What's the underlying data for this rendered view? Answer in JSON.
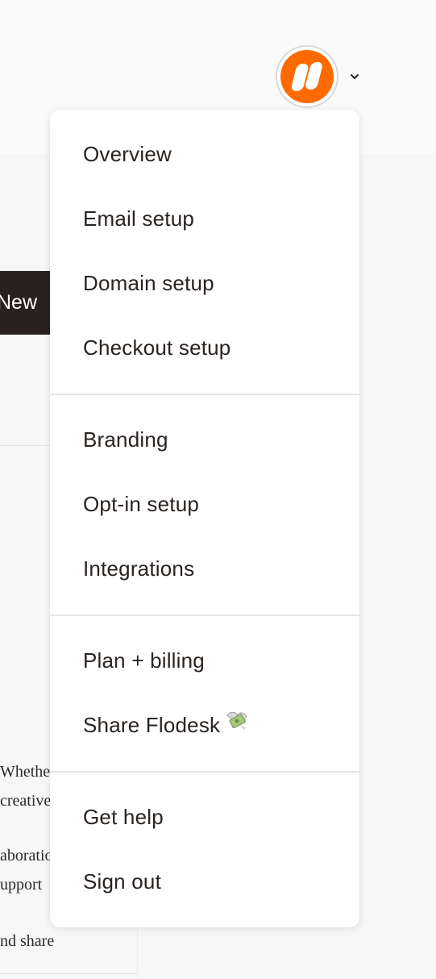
{
  "header": {
    "account_menu": {
      "avatar_icon": "flodesk-logo-icon",
      "avatar_color": "#ff6a00",
      "chevron_icon": "chevron-down-icon"
    }
  },
  "background": {
    "new_button_label": "New",
    "partial_text_lines": [
      "Whethe",
      "creative",
      "aboratio",
      "upport",
      "nd share"
    ]
  },
  "menu": {
    "groups": [
      {
        "items": [
          "Overview",
          "Email setup",
          "Domain setup",
          "Checkout setup"
        ]
      },
      {
        "items": [
          "Branding",
          "Opt-in setup",
          "Integrations"
        ]
      },
      {
        "items": [
          "Plan + billing",
          "Share Flodesk"
        ]
      },
      {
        "items": [
          "Get help",
          "Sign out"
        ]
      }
    ],
    "share_emoji_icon": "money-with-wings-icon"
  }
}
